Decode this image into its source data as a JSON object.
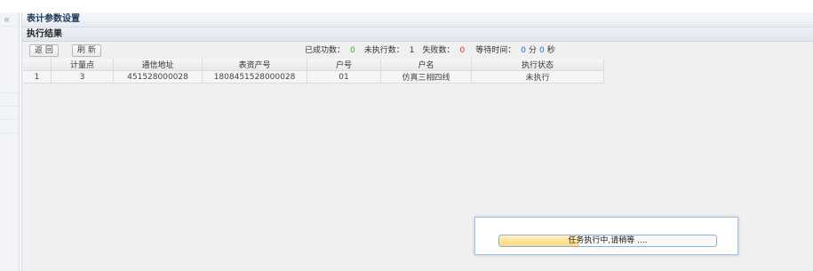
{
  "panel_title": "表计参数设置",
  "section_title": "执行结果",
  "toolbar": {
    "back_label": "返 回",
    "refresh_label": "刷 新"
  },
  "stats": {
    "success_label": "已成功数：",
    "success_value": "0",
    "pending_label": "未执行数：",
    "pending_value": "1",
    "failed_label": "失败数：",
    "failed_value": "0",
    "wait_label": "等待时间：",
    "wait_minutes": "0",
    "minute_unit": "分",
    "wait_seconds": "0",
    "second_unit": "秒"
  },
  "table": {
    "headers": [
      "",
      "计量点",
      "通信地址",
      "表资产号",
      "户号",
      "户名",
      "执行状态"
    ],
    "rows": [
      [
        "1",
        "3",
        "451528000028",
        "1808451528000028",
        "01",
        "仿真三相四线",
        "未执行"
      ]
    ]
  },
  "dialog": {
    "message": "任务执行中,请稍等 ....",
    "progress": 0.37
  },
  "icons": {
    "collapse": "double-chevron-left-icon"
  },
  "colors": {
    "success": "#3aa53a",
    "failed": "#e03030",
    "time": "#2b6bd6",
    "status_link": "#2b4fd6"
  }
}
